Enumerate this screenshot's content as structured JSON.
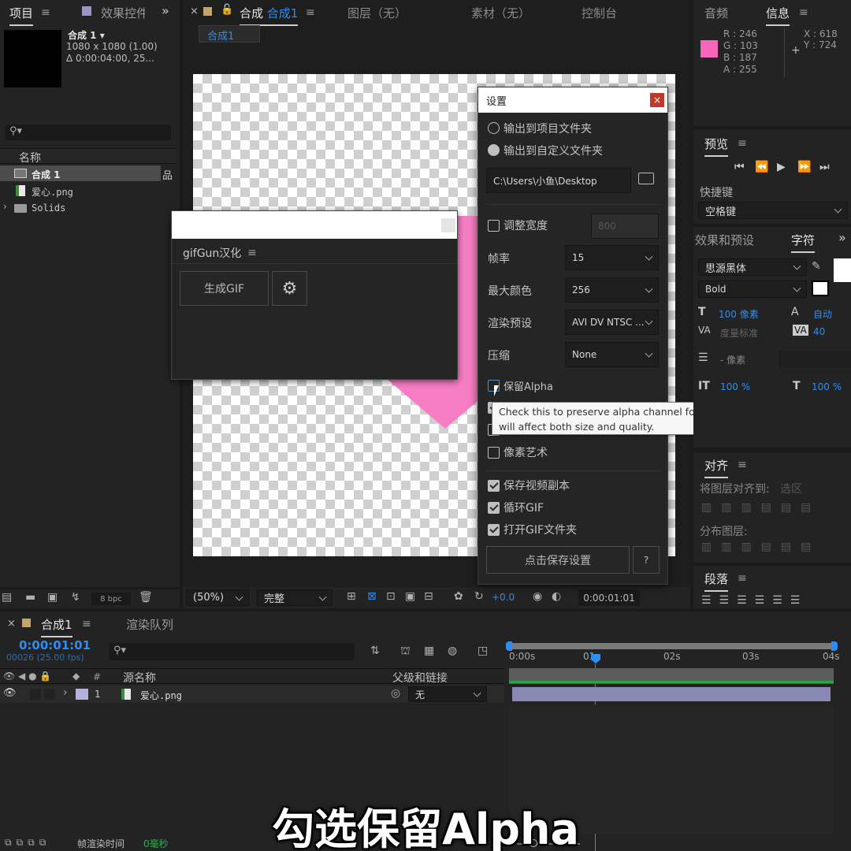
{
  "project_panel": {
    "tab_project": "项目",
    "tab_effects": "效果控件",
    "comp_name": "合成 1",
    "comp_size": "1080 x 1080 (1.00)",
    "comp_duration": "Δ 0:00:04:00, 25...",
    "column_name": "名称",
    "items": [
      {
        "label": "合成 1",
        "kind": "comp"
      },
      {
        "label": "爱心.png",
        "kind": "image"
      },
      {
        "label": "Solids",
        "kind": "folder"
      }
    ],
    "bpc": "8 bpc"
  },
  "composition_panel": {
    "tab_label": "合成",
    "tab_name": "合成1",
    "tab_layer": "图层（无）",
    "tab_footage": "素材（无）",
    "tab_console": "控制台",
    "breadcrumb": "合成1",
    "zoom": "(50%)",
    "quality": "完整",
    "exposure": "+0.0",
    "timecode": "0:00:01:01"
  },
  "gifgun_panel": {
    "title": "gifGun汉化",
    "generate_button": "生成GIF"
  },
  "settings_dialog": {
    "title": "设置",
    "radio_project_folder": "输出到项目文件夹",
    "radio_custom_folder": "输出到自定义文件夹",
    "path": "C:\\Users\\小鱼\\Desktop",
    "resize_label": "调整宽度",
    "resize_value": "800",
    "fps_label": "帧率",
    "fps_value": "15",
    "colors_label": "最大颜色",
    "colors_value": "256",
    "preset_label": "渲染预设",
    "preset_value": "AVI DV NTSC ...",
    "compress_label": "压缩",
    "compress_value": "None",
    "alpha_label": "保留Alpha",
    "pixel_art_label": "像素艺术",
    "keep_video_label": "保存视频副本",
    "loop_label": "循环GIF",
    "open_folder_label": "打开GIF文件夹",
    "save_button": "点击保存设置",
    "help_button": "?"
  },
  "tooltip": {
    "text": "Check this to preserve alpha channel for your GIFs. Note that this will affect both size and quality."
  },
  "info_panel": {
    "tab_audio": "音频",
    "tab_info": "信息",
    "swatch_color": "#f667bb",
    "r": "R : 246",
    "g": "G : 103",
    "b": "B : 187",
    "a": "A : 255",
    "x": "X : 618",
    "y": "Y : 724"
  },
  "preview_panel": {
    "title": "预览",
    "shortcut_label": "快捷键",
    "shortcut_value": "空格键"
  },
  "character_panel": {
    "tab_effects_presets": "效果和预设",
    "tab_character": "字符",
    "font_family": "思源黑体",
    "font_style": "Bold",
    "font_size": "100 像素",
    "leading": "自动",
    "kerning": "度量标准",
    "tracking": "40",
    "stroke": "- 像素",
    "vscale": "100 %",
    "hscale": "100 %"
  },
  "align_panel": {
    "title": "对齐",
    "align_to_label": "将图层对齐到:",
    "align_to_value": "选区",
    "distribute_label": "分布图层:"
  },
  "paragraph_panel": {
    "title": "段落"
  },
  "timeline": {
    "tab_comp": "合成1",
    "tab_render_queue": "渲染队列",
    "timecode": "0:00:01:01",
    "frame_info": "00026 (25.00 fps)",
    "col_source_name": "源名称",
    "col_parent": "父级和链接",
    "layer_index": "1",
    "layer_name": "爱心.png",
    "layer_parent": "无",
    "ruler": [
      "0:00s",
      "01s",
      "02s",
      "03s",
      "04s"
    ],
    "render_time_label": "帧渲染时间",
    "render_time_value": "0毫秒"
  },
  "caption": "勾选保留Alpha",
  "colors": {
    "accent_blue": "#2f8cf0",
    "heart_pink": "#f77dc4"
  }
}
